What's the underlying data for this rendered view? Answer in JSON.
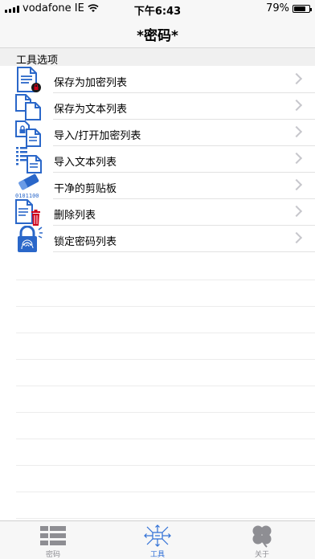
{
  "status_bar": {
    "carrier": "vodafone IE",
    "time": "下午6:43",
    "battery": "79%",
    "battery_level": 0.79
  },
  "nav": {
    "title": "*密码*"
  },
  "section": {
    "header": "工具选项"
  },
  "tools": [
    {
      "label": "保存为加密列表",
      "icon": "encrypted-document-icon"
    },
    {
      "label": "保存为文本列表",
      "icon": "copy-documents-icon"
    },
    {
      "label": "导入/打开加密列表",
      "icon": "locked-documents-icon"
    },
    {
      "label": "导入文本列表",
      "icon": "list-import-icon"
    },
    {
      "label": "干净的剪贴板",
      "icon": "eraser-binary-icon"
    },
    {
      "label": "删除列表",
      "icon": "delete-list-icon"
    },
    {
      "label": "锁定密码列表",
      "icon": "fingerprint-lock-icon"
    }
  ],
  "tab_bar": {
    "tabs": [
      {
        "label": "密码",
        "icon": "list-grid-icon",
        "active": false
      },
      {
        "label": "工具",
        "icon": "network-tools-icon",
        "active": true
      },
      {
        "label": "关于",
        "icon": "clover-icon",
        "active": false
      }
    ]
  },
  "colors": {
    "accent": "#2f6fd6",
    "icon_blue": "#2a67c9",
    "delete_red": "#d0021b",
    "tab_inactive": "#8e8e93"
  }
}
